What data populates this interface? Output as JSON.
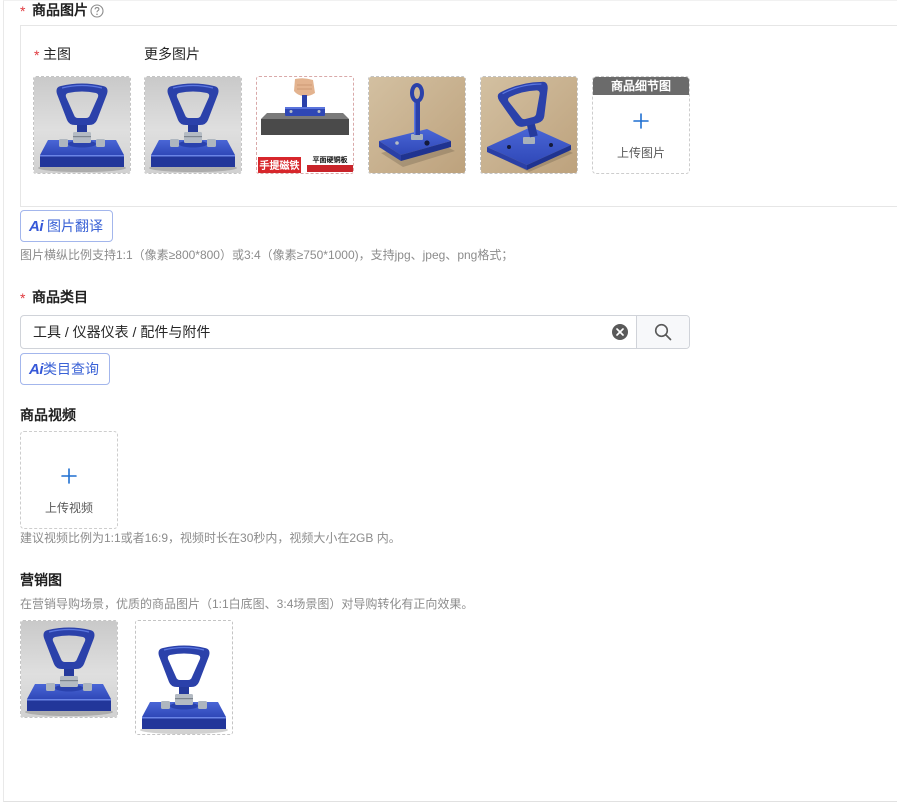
{
  "colors": {
    "accent": "#3a62d6",
    "plus": "#1f6fd1",
    "required": "#e0393e",
    "text": "#262626",
    "hint": "#8c8c8c",
    "border": "#d0d3d9",
    "detail_header_bg": "#6b6b6b"
  },
  "icons": {
    "help": "question-circle-icon",
    "plus": "plus-icon",
    "clear": "close-circle-icon",
    "search": "search-icon"
  },
  "product_images": {
    "required_mark": "*",
    "label": "商品图片",
    "main_required_mark": "*",
    "main_label": "主图",
    "more_label": "更多图片",
    "photo_text": {
      "banner": "手提磁铁",
      "caption": "平面硬铜板"
    },
    "detail_slot": {
      "header": "商品细节图",
      "upload_label": "上传图片"
    },
    "translate_button": {
      "ai_badge": "Ai",
      "label": "图片翻译"
    },
    "hint": "图片横纵比例支持1:1（像素≥800*800）或3:4（像素≥750*1000)，支持jpg、jpeg、png格式；"
  },
  "category": {
    "required_mark": "*",
    "label": "商品类目",
    "value": "工具 / 仪器仪表 / 配件与附件",
    "ai_button": {
      "ai_badge": "Ai",
      "label": "类目查询"
    }
  },
  "video": {
    "label": "商品视频",
    "upload_label": "上传视频",
    "hint": "建议视频比例为1:1或者16:9，视频时长在30秒内，视频大小在2GB 内。"
  },
  "marketing": {
    "label": "营销图",
    "hint": "在营销导购场景，优质的商品图片（1:1白底图、3:4场景图）对导购转化有正向效果。"
  }
}
